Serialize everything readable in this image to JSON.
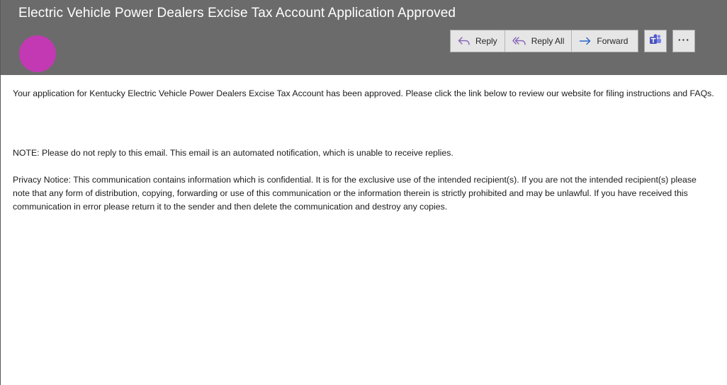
{
  "email": {
    "subject": "Electric Vehicle Power Dealers Excise Tax Account Application Approved",
    "avatar_color": "#c239b3"
  },
  "toolbar": {
    "reply_label": "Reply",
    "reply_all_label": "Reply All",
    "forward_label": "Forward",
    "teams_icon": "teams-icon",
    "more_icon": "more-options-icon",
    "more_label": "···"
  },
  "body": {
    "paragraph_1": "Your application for Kentucky Electric Vehicle Power Dealers Excise Tax Account has been approved. Please click the link below to review our website for filing instructions and FAQs.",
    "paragraph_2": "NOTE: Please do not reply to this email. This email is an automated notification, which is unable to receive replies.",
    "paragraph_3": "Privacy Notice: This communication contains information which is confidential. It is for the exclusive use of the intended recipient(s). If you are not the intended recipient(s) please note that any form of distribution, copying, forwarding or use of this communication or the information therein is strictly prohibited and may be unlawful. If you have received this communication in error please return it to the sender and then delete the communication and destroy any copies."
  },
  "colors": {
    "header_bg": "#6b6b6b",
    "button_bg": "#e6e6e6",
    "reply_arrow": "#8764b8",
    "forward_arrow": "#2b65c9",
    "teams_brand": "#4b53bc"
  }
}
